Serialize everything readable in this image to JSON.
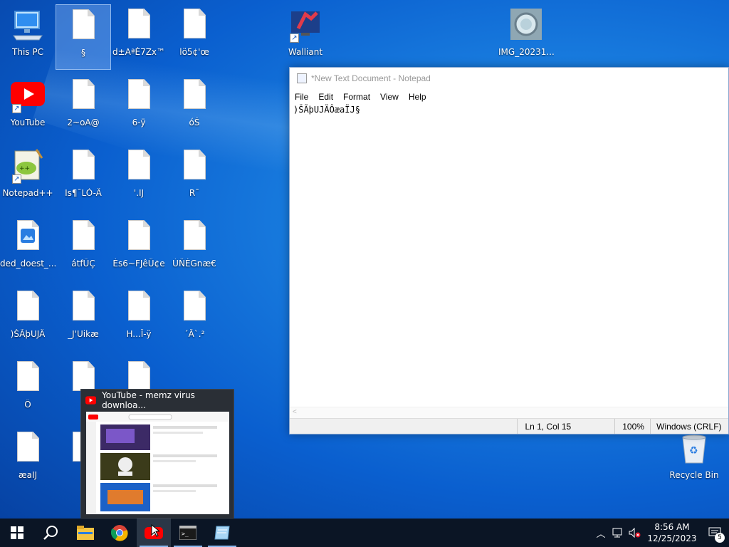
{
  "desktop": {
    "icons": [
      {
        "label": "This PC"
      },
      {
        "label": "§"
      },
      {
        "label": "d±AªÈ7Zx™"
      },
      {
        "label": "lö5¢'œ"
      },
      {
        "label": "Walliant"
      },
      {
        "label": "IMG_20231..."
      },
      {
        "label": "YouTube"
      },
      {
        "label": "2~oA@"
      },
      {
        "label": "6-ÿ"
      },
      {
        "label": "óŠ"
      },
      {
        "label": "Notepad++"
      },
      {
        "label": "Is¶¯LÒ-Ä"
      },
      {
        "label": "'.IJ"
      },
      {
        "label": "R¯"
      },
      {
        "label": "ded_doest_..."
      },
      {
        "label": "átfÛÇ"
      },
      {
        "label": "Ès6~FJêÜ¢e"
      },
      {
        "label": "ÚÑÈGnæ€"
      },
      {
        "label": ")ŠÃþUJÄ"
      },
      {
        "label": "_J'Uikæ"
      },
      {
        "label": "H...Î-ÿ"
      },
      {
        "label": "´Â`.²"
      },
      {
        "label": "Ô"
      },
      {
        "label": "æaIJ"
      },
      {
        "label": "Recycle Bin"
      }
    ]
  },
  "notepad": {
    "title": "*New Text Document - Notepad",
    "menu": [
      "File",
      "Edit",
      "Format",
      "View",
      "Help"
    ],
    "content": ")ŠÃþUJÄÔæaÏJ§",
    "status": {
      "position": "Ln 1, Col 15",
      "zoom": "100%",
      "encoding": "Windows (CRLF)"
    }
  },
  "preview": {
    "title": "YouTube - memz virus downloa..."
  },
  "taskbar": {
    "apps": [
      "start-icon",
      "search-icon",
      "file-explorer-icon",
      "chrome-icon",
      "youtube-icon",
      "cmd-icon",
      "notepad-icon"
    ],
    "clock": {
      "time": "8:56 AM",
      "date": "12/25/2023"
    },
    "notifications": "5"
  },
  "colors": {
    "accent": "#0a5fcf",
    "taskbar": "#0b1525",
    "youtube_red": "#ff0000"
  }
}
